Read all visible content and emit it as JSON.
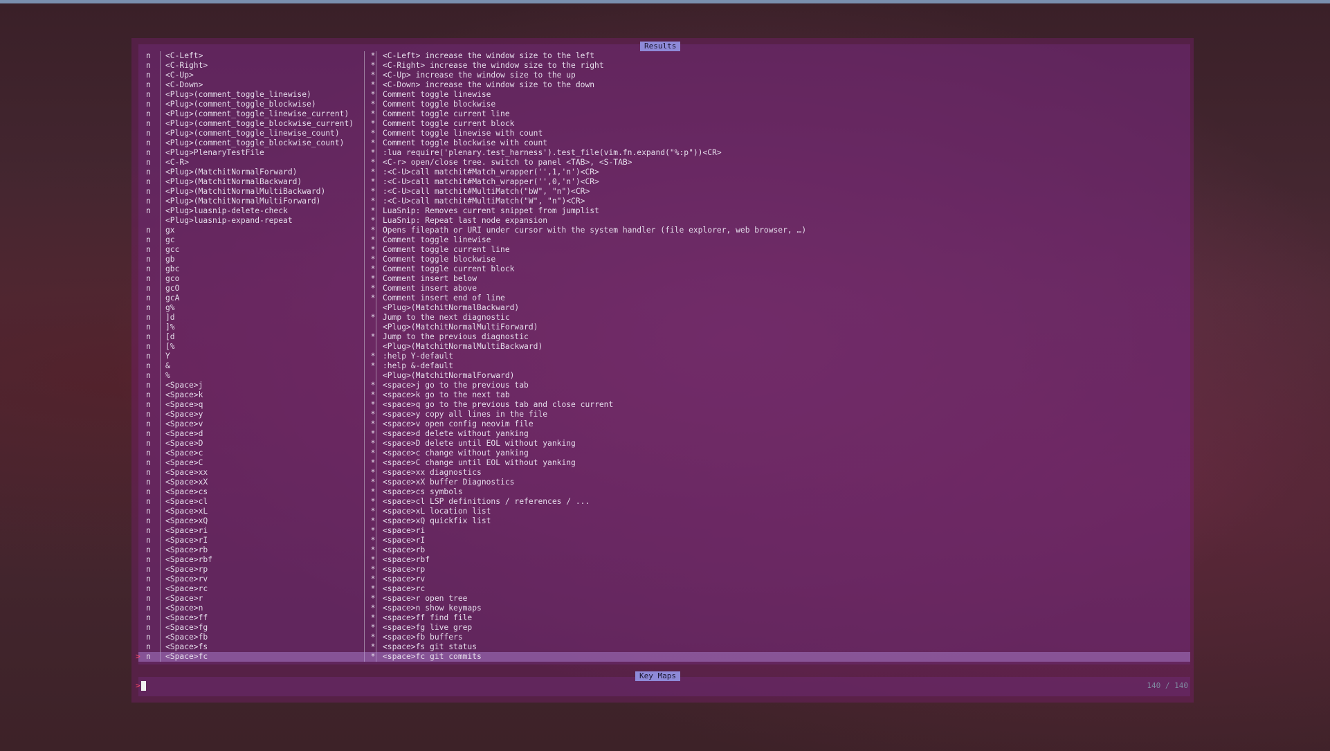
{
  "results_title": "Results",
  "prompt": {
    "title": "Key Maps",
    "prefix": ">",
    "value": "",
    "counter": "140 / 140"
  },
  "colors": {
    "accent": "#8e8ad8",
    "selection": "#a78ad0",
    "caret": "#ff4a6a"
  },
  "rows": [
    {
      "mode": "n",
      "lhs": "<C-Left>",
      "flag": "*",
      "desc": "<C-Left> increase the window size to the left"
    },
    {
      "mode": "n",
      "lhs": "<C-Right>",
      "flag": "*",
      "desc": "<C-Right> increase the window size to the right"
    },
    {
      "mode": "n",
      "lhs": "<C-Up>",
      "flag": "*",
      "desc": "<C-Up> increase the window size to the up"
    },
    {
      "mode": "n",
      "lhs": "<C-Down>",
      "flag": "*",
      "desc": "<C-Down> increase the window size to the down"
    },
    {
      "mode": "n",
      "lhs": "<Plug>(comment_toggle_linewise)",
      "flag": "*",
      "desc": "Comment toggle linewise"
    },
    {
      "mode": "n",
      "lhs": "<Plug>(comment_toggle_blockwise)",
      "flag": "*",
      "desc": "Comment toggle blockwise"
    },
    {
      "mode": "n",
      "lhs": "<Plug>(comment_toggle_linewise_current)",
      "flag": "*",
      "desc": "Comment toggle current line"
    },
    {
      "mode": "n",
      "lhs": "<Plug>(comment_toggle_blockwise_current)",
      "flag": "*",
      "desc": "Comment toggle current block"
    },
    {
      "mode": "n",
      "lhs": "<Plug>(comment_toggle_linewise_count)",
      "flag": "*",
      "desc": "Comment toggle linewise with count"
    },
    {
      "mode": "n",
      "lhs": "<Plug>(comment_toggle_blockwise_count)",
      "flag": "*",
      "desc": "Comment toggle blockwise with count"
    },
    {
      "mode": "n",
      "lhs": "<Plug>PlenaryTestFile",
      "flag": "*",
      "desc": ":lua require('plenary.test_harness').test_file(vim.fn.expand(\"%:p\"))<CR>"
    },
    {
      "mode": "n",
      "lhs": "<C-R>",
      "flag": "*",
      "desc": "<C-r> open/close tree. switch to panel <TAB>, <S-TAB>"
    },
    {
      "mode": "n",
      "lhs": "<Plug>(MatchitNormalForward)",
      "flag": "*",
      "desc": ":<C-U>call matchit#Match_wrapper('',1,'n')<CR>"
    },
    {
      "mode": "n",
      "lhs": "<Plug>(MatchitNormalBackward)",
      "flag": "*",
      "desc": ":<C-U>call matchit#Match_wrapper('',0,'n')<CR>"
    },
    {
      "mode": "n",
      "lhs": "<Plug>(MatchitNormalMultiBackward)",
      "flag": "*",
      "desc": ":<C-U>call matchit#MultiMatch(\"bW\", \"n\")<CR>"
    },
    {
      "mode": "n",
      "lhs": "<Plug>(MatchitNormalMultiForward)",
      "flag": "*",
      "desc": ":<C-U>call matchit#MultiMatch(\"W\", \"n\")<CR>"
    },
    {
      "mode": "n",
      "lhs": "<Plug>luasnip-delete-check",
      "flag": "*",
      "desc": "LuaSnip: Removes current snippet from jumplist"
    },
    {
      "mode": "",
      "lhs": "<Plug>luasnip-expand-repeat",
      "flag": "*",
      "desc": "LuaSnip: Repeat last node expansion"
    },
    {
      "mode": "n",
      "lhs": "gx",
      "flag": "*",
      "desc": "Opens filepath or URI under cursor with the system handler (file explorer, web browser, …)"
    },
    {
      "mode": "n",
      "lhs": "gc",
      "flag": "*",
      "desc": "Comment toggle linewise"
    },
    {
      "mode": "n",
      "lhs": "gcc",
      "flag": "*",
      "desc": "Comment toggle current line"
    },
    {
      "mode": "n",
      "lhs": "gb",
      "flag": "*",
      "desc": "Comment toggle blockwise"
    },
    {
      "mode": "n",
      "lhs": "gbc",
      "flag": "*",
      "desc": "Comment toggle current block"
    },
    {
      "mode": "n",
      "lhs": "gco",
      "flag": "*",
      "desc": "Comment insert below"
    },
    {
      "mode": "n",
      "lhs": "gcO",
      "flag": "*",
      "desc": "Comment insert above"
    },
    {
      "mode": "n",
      "lhs": "gcA",
      "flag": "*",
      "desc": "Comment insert end of line"
    },
    {
      "mode": "n",
      "lhs": "g%",
      "flag": "",
      "desc": "<Plug>(MatchitNormalBackward)"
    },
    {
      "mode": "n",
      "lhs": "]d",
      "flag": "*",
      "desc": "Jump to the next diagnostic"
    },
    {
      "mode": "n",
      "lhs": "]%",
      "flag": "",
      "desc": "<Plug>(MatchitNormalMultiForward)"
    },
    {
      "mode": "n",
      "lhs": "[d",
      "flag": "*",
      "desc": "Jump to the previous diagnostic"
    },
    {
      "mode": "n",
      "lhs": "[%",
      "flag": "",
      "desc": "<Plug>(MatchitNormalMultiBackward)"
    },
    {
      "mode": "n",
      "lhs": "Y",
      "flag": "*",
      "desc": ":help Y-default"
    },
    {
      "mode": "n",
      "lhs": "&",
      "flag": "*",
      "desc": ":help &-default"
    },
    {
      "mode": "n",
      "lhs": "%",
      "flag": "",
      "desc": "<Plug>(MatchitNormalForward)"
    },
    {
      "mode": "n",
      "lhs": "<Space>j",
      "flag": "*",
      "desc": "<space>j go to the previous tab"
    },
    {
      "mode": "n",
      "lhs": "<Space>k",
      "flag": "*",
      "desc": "<space>k go to the next tab"
    },
    {
      "mode": "n",
      "lhs": "<Space>q",
      "flag": "*",
      "desc": "<space>q go to the previous tab and close current"
    },
    {
      "mode": "n",
      "lhs": "<Space>y",
      "flag": "*",
      "desc": "<space>y copy all lines in the file"
    },
    {
      "mode": "n",
      "lhs": "<Space>v",
      "flag": "*",
      "desc": "<space>v open config neovim file"
    },
    {
      "mode": "n",
      "lhs": "<Space>d",
      "flag": "*",
      "desc": "<space>d delete without yanking"
    },
    {
      "mode": "n",
      "lhs": "<Space>D",
      "flag": "*",
      "desc": "<space>D delete until EOL without yanking"
    },
    {
      "mode": "n",
      "lhs": "<Space>c",
      "flag": "*",
      "desc": "<space>c change without yanking"
    },
    {
      "mode": "n",
      "lhs": "<Space>C",
      "flag": "*",
      "desc": "<space>C change until EOL without yanking"
    },
    {
      "mode": "n",
      "lhs": "<Space>xx",
      "flag": "*",
      "desc": "<space>xx diagnostics"
    },
    {
      "mode": "n",
      "lhs": "<Space>xX",
      "flag": "*",
      "desc": "<space>xX buffer Diagnostics"
    },
    {
      "mode": "n",
      "lhs": "<Space>cs",
      "flag": "*",
      "desc": "<space>cs symbols"
    },
    {
      "mode": "n",
      "lhs": "<Space>cl",
      "flag": "*",
      "desc": "<space>cl LSP definitions / references / ..."
    },
    {
      "mode": "n",
      "lhs": "<Space>xL",
      "flag": "*",
      "desc": "<space>xL location list"
    },
    {
      "mode": "n",
      "lhs": "<Space>xQ",
      "flag": "*",
      "desc": "<space>xQ quickfix list"
    },
    {
      "mode": "n",
      "lhs": "<Space>ri",
      "flag": "*",
      "desc": "<space>ri"
    },
    {
      "mode": "n",
      "lhs": "<Space>rI",
      "flag": "*",
      "desc": "<space>rI"
    },
    {
      "mode": "n",
      "lhs": "<Space>rb",
      "flag": "*",
      "desc": "<space>rb"
    },
    {
      "mode": "n",
      "lhs": "<Space>rbf",
      "flag": "*",
      "desc": "<space>rbf"
    },
    {
      "mode": "n",
      "lhs": "<Space>rp",
      "flag": "*",
      "desc": "<space>rp"
    },
    {
      "mode": "n",
      "lhs": "<Space>rv",
      "flag": "*",
      "desc": "<space>rv"
    },
    {
      "mode": "n",
      "lhs": "<Space>rc",
      "flag": "*",
      "desc": "<space>rc"
    },
    {
      "mode": "n",
      "lhs": "<Space>r",
      "flag": "*",
      "desc": "<space>r open tree"
    },
    {
      "mode": "n",
      "lhs": "<Space>n",
      "flag": "*",
      "desc": "<space>n show keymaps"
    },
    {
      "mode": "n",
      "lhs": "<Space>ff",
      "flag": "*",
      "desc": "<space>ff find file"
    },
    {
      "mode": "n",
      "lhs": "<Space>fg",
      "flag": "*",
      "desc": "<space>fg live grep"
    },
    {
      "mode": "n",
      "lhs": "<Space>fb",
      "flag": "*",
      "desc": "<space>fb buffers"
    },
    {
      "mode": "n",
      "lhs": "<Space>fs",
      "flag": "*",
      "desc": "<space>fs git status"
    },
    {
      "mode": "n",
      "lhs": "<Space>fc",
      "flag": "*",
      "desc": "<space>fc git commits",
      "selected": true,
      "caret": ">"
    }
  ]
}
